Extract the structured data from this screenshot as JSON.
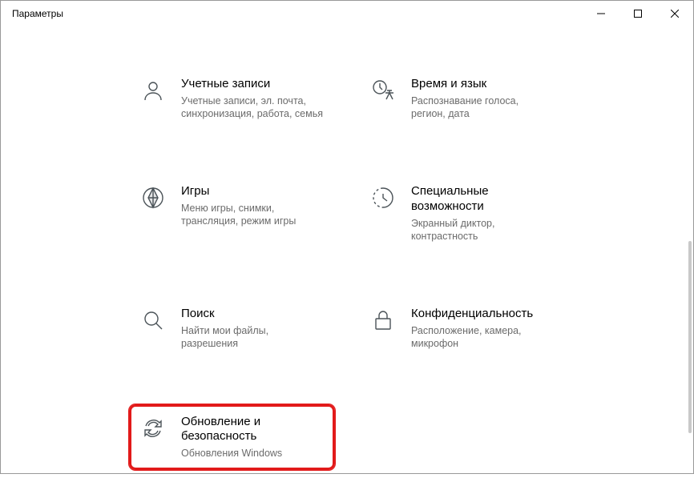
{
  "window": {
    "title": "Параметры"
  },
  "tiles": {
    "accounts": {
      "title": "Учетные записи",
      "desc": "Учетные записи, эл. почта, синхронизация, работа, семья"
    },
    "time": {
      "title": "Время и язык",
      "desc": "Распознавание голоса, регион, дата"
    },
    "gaming": {
      "title": "Игры",
      "desc": "Меню игры, снимки, трансляция, режим игры"
    },
    "ease": {
      "title": "Специальные возможности",
      "desc": "Экранный диктор, контрастность"
    },
    "search": {
      "title": "Поиск",
      "desc": "Найти мои файлы, разрешения"
    },
    "privacy": {
      "title": "Конфиденциальность",
      "desc": "Расположение, камера, микрофон"
    },
    "update": {
      "title": "Обновление и безопасность",
      "desc": "Обновления Windows"
    }
  }
}
